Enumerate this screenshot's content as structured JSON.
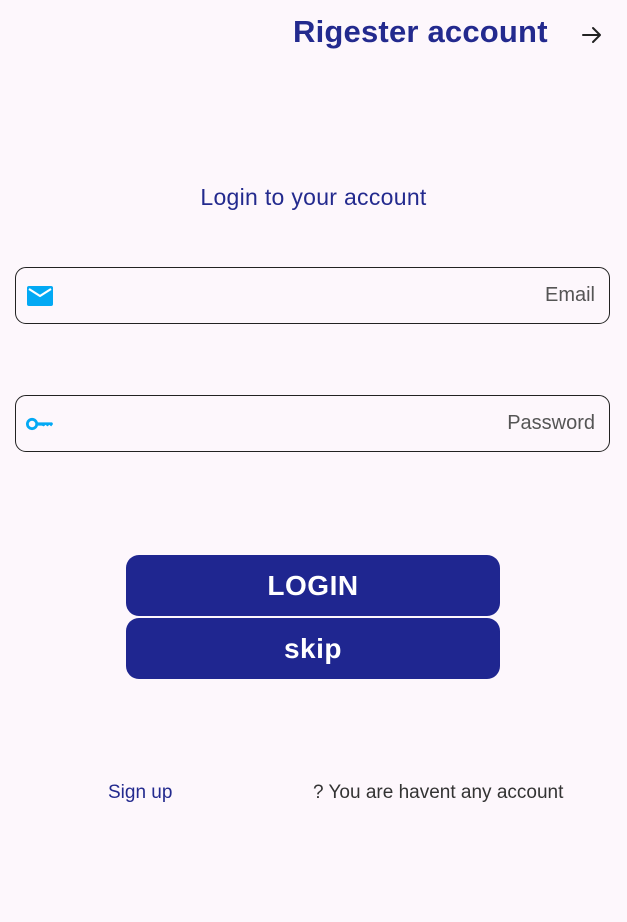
{
  "header": {
    "title": "Rigester account",
    "arrow_icon": "arrow-right-icon"
  },
  "login": {
    "heading": "Login to your account",
    "email": {
      "placeholder": "Email",
      "value": "",
      "icon": "mail-icon"
    },
    "password": {
      "placeholder": "Password",
      "value": "",
      "icon": "key-icon"
    },
    "login_label": "LOGIN",
    "skip_label": "skip"
  },
  "footer": {
    "signup_label": "Sign up",
    "no_account_text": "? You are havent any account"
  },
  "colors": {
    "background": "#fdf7fc",
    "primary": "#1f2690",
    "title": "#232a8e",
    "icon_accent": "#03a9f4"
  }
}
